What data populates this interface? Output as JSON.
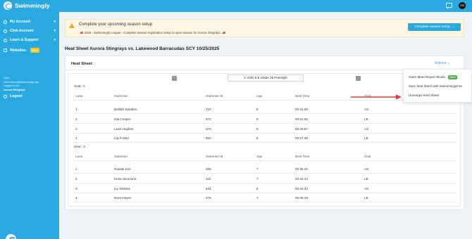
{
  "app": {
    "name": "Swimmingly"
  },
  "sidebar": {
    "items": [
      {
        "label": "My Account",
        "icon": "user-icon"
      },
      {
        "label": "Club Account",
        "icon": "users-icon"
      },
      {
        "label": "Learn & Support",
        "icon": "help-icon"
      },
      {
        "label": "Websites",
        "icon": "browser-icon",
        "badge": "NEW"
      }
    ],
    "user": {
      "role_label": "User:",
      "email": "hello+demo@swimmingly.app",
      "logged_in_label": "Logged in as",
      "club": "Aurora Stingrays"
    },
    "logout": "Logout"
  },
  "banner": {
    "title": "Complete your upcoming season setup",
    "subtitle": "2026 - Swimmingly League - Complete season registration setup to open season for Aurora Stingrays.",
    "button": "Complete season setup"
  },
  "page_title": "Heat Sheet Aurora Stingrays vs. Lakewood Barracudas SCY 10/25/2025",
  "card": {
    "header": "Heat Sheet",
    "actions_label": "Actions",
    "event_select": "1: Girls 8 & Under 25 Freestyle"
  },
  "columns": [
    "Lane",
    "Swimmer",
    "Swimmer Id",
    "Age",
    "Best Time",
    "Club"
  ],
  "heats": [
    {
      "label": "Heat : 1",
      "rows": [
        [
          "1",
          "Delilah Sanders",
          "715",
          "8",
          "00:31.09",
          "AS"
        ],
        [
          "2",
          "Isla Cooper",
          "872",
          "8",
          "00:21.32",
          "LB"
        ],
        [
          "3",
          "Leah Hughes",
          "276",
          "8",
          "00:28.67",
          "AS"
        ],
        [
          "4",
          "Lily Foster",
          "652",
          "8",
          "00:27.46",
          "LB"
        ]
      ]
    },
    {
      "label": "Heat : 2",
      "rows": [
        [
          "1",
          "Natalie Kim",
          "206",
          "7",
          "00:38.40",
          "AS"
        ],
        [
          "2",
          "Keira Simmons",
          "110",
          "7",
          "00:32.14",
          "LB"
        ],
        [
          "3",
          "Ivy Jenkins",
          "541",
          "8",
          "00:33.33",
          "AS"
        ],
        [
          "4",
          "Nora Hayes",
          "078",
          "7",
          "00:36.18",
          "LB"
        ]
      ]
    }
  ],
  "dropdown": {
    "items": [
      {
        "label": "Swim Meet Report Studio",
        "badge": "NEW"
      },
      {
        "label": "Sync heat sheet with SwimminglyFan"
      },
      {
        "label": "Unmerge Heat Sheet"
      }
    ]
  },
  "colors": {
    "brand": "#29a9df",
    "annotation_arrow": "#e53935",
    "new_badge": "#4caf50"
  }
}
